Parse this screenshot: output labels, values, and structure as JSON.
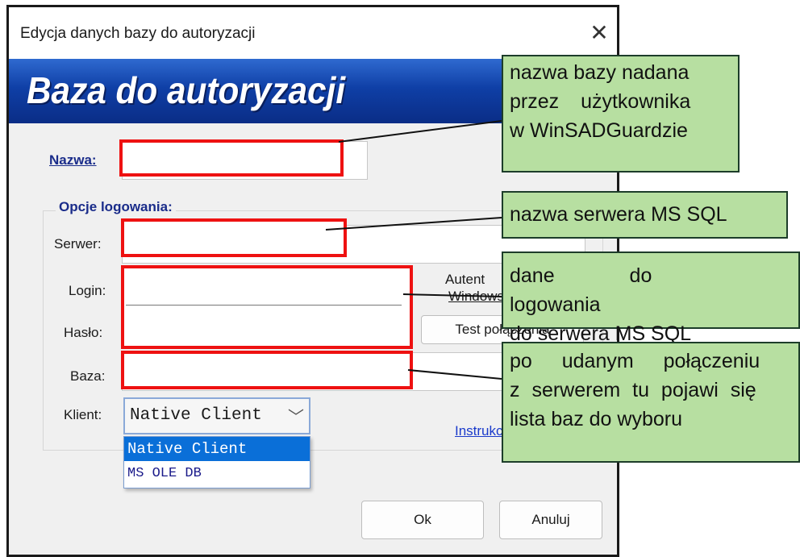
{
  "window": {
    "title": "Edycja danych bazy do autoryzacji",
    "close_glyph": "✕",
    "banner_title": "Baza do autoryzacji"
  },
  "form": {
    "name_label": "Nazwa:",
    "name_value": "",
    "login_options_heading": "Opcje logowania:",
    "server_label": "Serwer:",
    "server_value": "",
    "login_label": "Login:",
    "login_value": "",
    "password_label": "Hasło:",
    "password_value": "",
    "database_label": "Baza:",
    "database_value": "",
    "client_label": "Klient:",
    "client_selected": "Native Client",
    "client_options": [
      "Native Client",
      "MS OLE DB"
    ],
    "windows_auth_label_1": "Autent",
    "windows_auth_label_2": "Windows",
    "test_button": "Test połączenia",
    "instructions_link": "Instrukcja online"
  },
  "buttons": {
    "ok": "Ok",
    "cancel": "Anuluj"
  },
  "annotations": {
    "name_note": [
      "nazwa bazy nadana",
      "przez użytkownika",
      "w WinSADGuardzie"
    ],
    "server_note": [
      "nazwa serwera MS SQL"
    ],
    "login_note": [
      "dane do logowania",
      "do serwera MS SQL"
    ],
    "database_note": [
      "po udanym połączeniu",
      "z serwerem tu pojawi się",
      "lista baz do wyboru"
    ]
  },
  "colors": {
    "banner": "#0f3fa6",
    "highlight_box": "#ee1111",
    "note_background": "#b7dfa1",
    "dropdown_selected": "#0a6fd8"
  },
  "icons": {
    "combo_chevron": "chevron-down-icon",
    "close": "close-icon"
  }
}
